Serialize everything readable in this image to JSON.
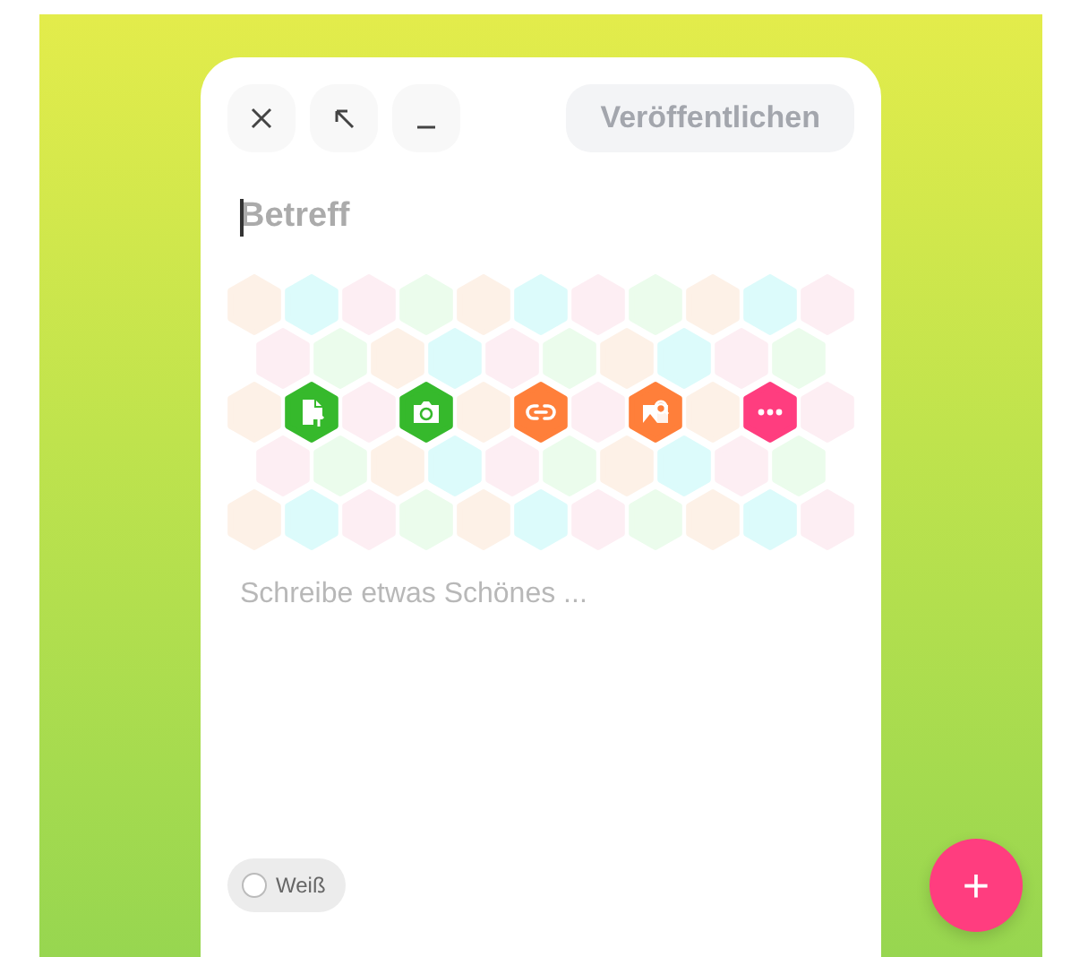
{
  "toolbar": {
    "buttons": [
      {
        "kind": "close"
      },
      {
        "kind": "expand"
      },
      {
        "kind": "minimize"
      }
    ],
    "publish": {
      "label": "Veröffentlichen",
      "disabled": true
    }
  },
  "subject": {
    "placeholder": "Betreff",
    "focused": true
  },
  "attachments": [
    {
      "kind": "file-upload",
      "color": "#36b92c"
    },
    {
      "kind": "camera",
      "color": "#36b92c"
    },
    {
      "kind": "link",
      "color": "#ff7f3a"
    },
    {
      "kind": "image-search",
      "color": "#ff7f3a"
    },
    {
      "kind": "more",
      "color": "#ff3d7f"
    }
  ],
  "body": {
    "placeholder": "Schreibe etwas Schönes ..."
  },
  "color_option": {
    "label": "Weiß",
    "selected": false
  },
  "fab": {
    "label": "+"
  }
}
